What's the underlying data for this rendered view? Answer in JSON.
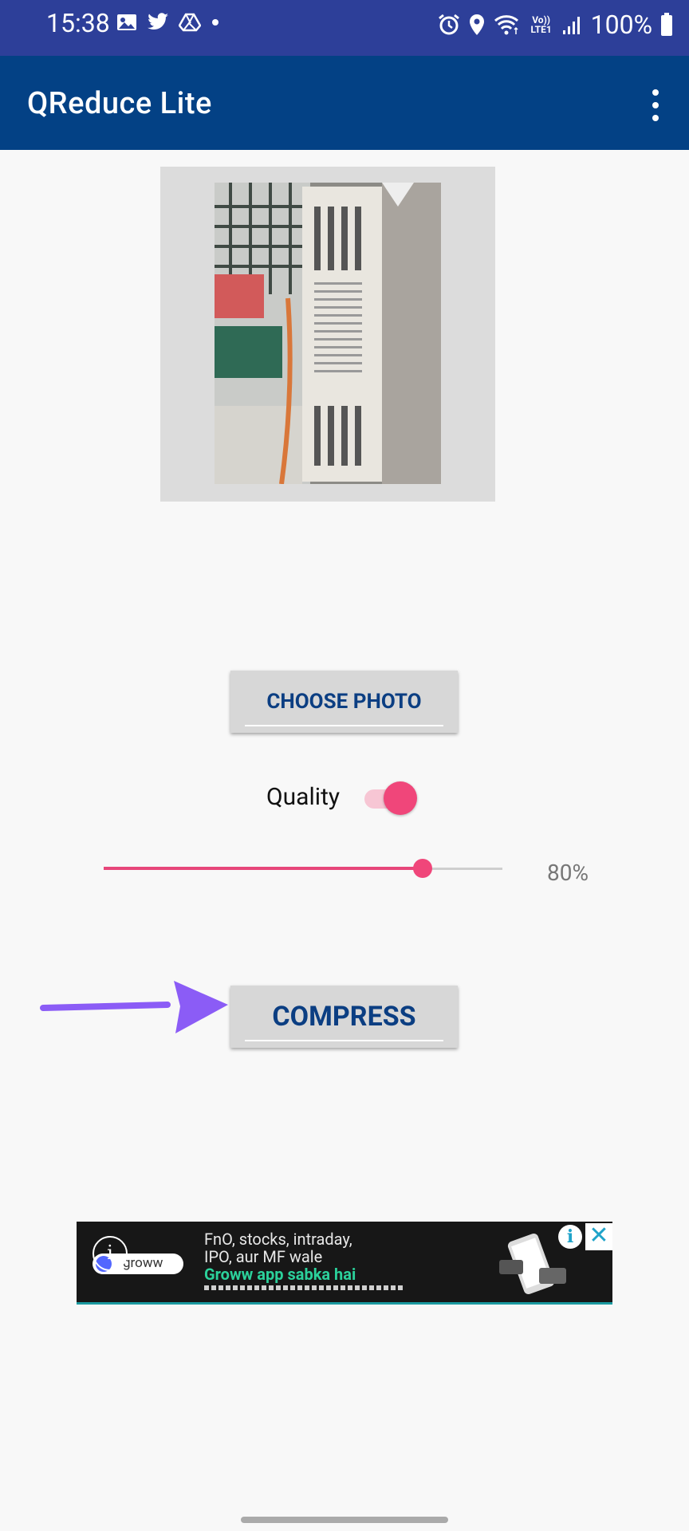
{
  "status_bar": {
    "time": "15:38",
    "left_icons": [
      "gallery-icon",
      "twitter-icon",
      "drive-icon",
      "dot-icon"
    ],
    "right_icons": [
      "alarm-icon",
      "location-icon",
      "wifi-icon",
      "volte-icon",
      "signal-icon",
      "battery-icon"
    ],
    "volte_label": "Vo)) LTE1",
    "battery": "100%"
  },
  "app_bar": {
    "title": "QReduce Lite",
    "menu_icon": "more-vert-icon"
  },
  "main": {
    "choose_photo_label": "CHOOSE PHOTO",
    "quality_label": "Quality",
    "quality_toggle_on": true,
    "slider_percent": 80,
    "slider_value": "80%",
    "compress_label": "COMPRESS",
    "annotation_arrow_color": "#8b5cf6"
  },
  "ad": {
    "line1": "FnO, stocks, intraday,",
    "line2": "IPO, aur MF wale",
    "line3": "Groww app sabka hai",
    "brand": "groww",
    "info_label": "i",
    "adchoices_label": "i",
    "close_label": "✕"
  },
  "colors": {
    "status_bar": "#2d3f99",
    "app_bar": "#034185",
    "accent": "#f0467a",
    "button_text": "#0b3e82"
  }
}
